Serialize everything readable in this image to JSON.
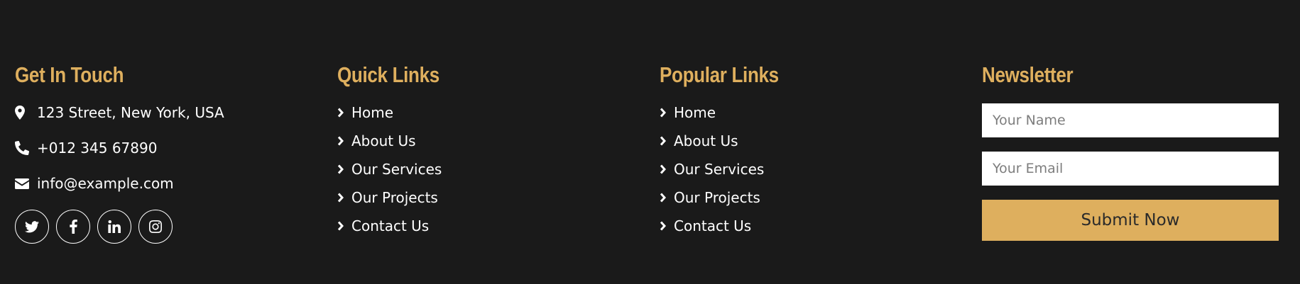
{
  "colors": {
    "background": "#1a1a1a",
    "accent": "#deaf5e",
    "text": "#ffffff"
  },
  "contact": {
    "title": "Get In Touch",
    "address": "123 Street, New York, USA",
    "phone": "+012 345 67890",
    "email": "info@example.com",
    "address_icon": "map-marker-icon",
    "phone_icon": "phone-icon",
    "email_icon": "envelope-icon",
    "socials": [
      "twitter-icon",
      "facebook-icon",
      "linkedin-icon",
      "instagram-icon"
    ]
  },
  "quick_links": {
    "title": "Quick Links",
    "items": [
      {
        "label": "Home"
      },
      {
        "label": "About Us"
      },
      {
        "label": "Our Services"
      },
      {
        "label": "Our Projects"
      },
      {
        "label": "Contact Us"
      }
    ]
  },
  "popular_links": {
    "title": "Popular Links",
    "items": [
      {
        "label": "Home"
      },
      {
        "label": "About Us"
      },
      {
        "label": "Our Services"
      },
      {
        "label": "Our Projects"
      },
      {
        "label": "Contact Us"
      }
    ]
  },
  "newsletter": {
    "title": "Newsletter",
    "name_placeholder": "Your Name",
    "email_placeholder": "Your Email",
    "submit_label": "Submit Now"
  }
}
